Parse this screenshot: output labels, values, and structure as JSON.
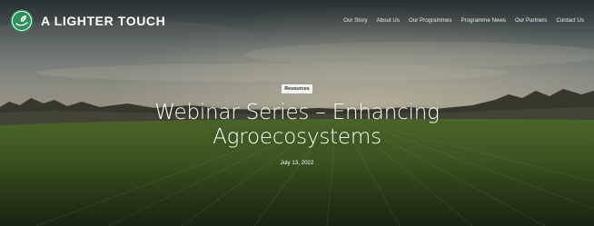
{
  "brand": {
    "name": "A LIGHTER TOUCH",
    "logo_icon": "leaf-hand-logo-icon",
    "logo_color": "#2f8f5b"
  },
  "nav": {
    "items": [
      {
        "label": "Our Story"
      },
      {
        "label": "About Us"
      },
      {
        "label": "Our Programmes"
      },
      {
        "label": "Programme News"
      },
      {
        "label": "Our Partners"
      },
      {
        "label": "Contact Us"
      }
    ]
  },
  "hero": {
    "category": "Resources",
    "title": "Webinar Series – Enhancing Agroecosystems",
    "date": "July 13, 2022",
    "image": "field-landscape-image"
  }
}
